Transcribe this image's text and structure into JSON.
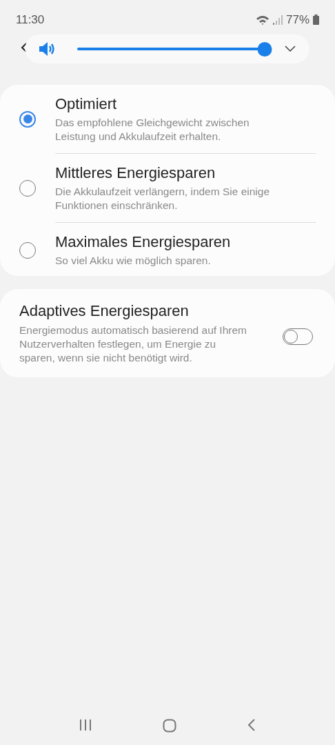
{
  "status_bar": {
    "time": "11:30",
    "battery": "77%"
  },
  "volume_panel": {
    "level": 1
  },
  "modes": [
    {
      "title": "Optimiert",
      "description": "Das empfohlene Gleichgewicht zwischen Leistung und Akkulaufzeit erhalten.",
      "selected": true
    },
    {
      "title": "Mittleres Energiesparen",
      "description": "Die Akkulaufzeit verlängern, indem Sie einige Funktionen einschränken.",
      "selected": false
    },
    {
      "title": "Maximales Energiesparen",
      "description": "So viel Akku wie möglich sparen.",
      "selected": false
    }
  ],
  "adaptive": {
    "title": "Adaptives Energiesparen",
    "description": "Energiemodus automatisch basierend auf Ihrem Nutzerverhalten festlegen, um Energie zu sparen, wenn sie nicht benötigt wird.",
    "on": false
  }
}
